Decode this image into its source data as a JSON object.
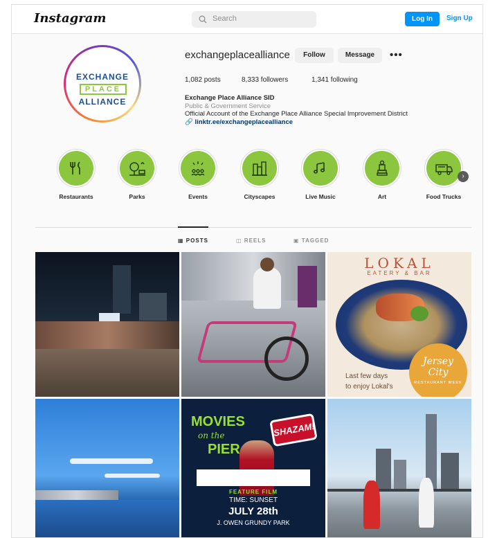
{
  "brand": {
    "logo_text": "Instagram"
  },
  "header": {
    "search_placeholder": "Search",
    "login_label": "Log In",
    "signup_label": "Sign Up"
  },
  "profile": {
    "avatar": {
      "line1": "EXCHANGE",
      "line2": "PLACE",
      "line3": "ALLIANCE"
    },
    "username": "exchangeplacealliance",
    "follow_label": "Follow",
    "message_label": "Message",
    "more_label": "•••",
    "stats": {
      "posts": "1,082 posts",
      "followers": "8,333 followers",
      "following": "1,341 following"
    },
    "bio": {
      "name": "Exchange Place Alliance SID",
      "category": "Public & Government Service",
      "text": "Official Account of the Exchange Place Alliance Special Improvement District",
      "link": "linktr.ee/exchangeplacealliance"
    }
  },
  "highlights": [
    {
      "label": "Restaurants",
      "icon": "utensils-icon"
    },
    {
      "label": "Parks",
      "icon": "tree-icon"
    },
    {
      "label": "Events",
      "icon": "confetti-icon"
    },
    {
      "label": "Cityscapes",
      "icon": "city-icon"
    },
    {
      "label": "Live Music",
      "icon": "music-notes-icon"
    },
    {
      "label": "Art",
      "icon": "statue-icon"
    },
    {
      "label": "Food Trucks",
      "icon": "food-truck-icon"
    }
  ],
  "tabs": [
    {
      "label": "POSTS",
      "active": true
    },
    {
      "label": "REELS",
      "active": false
    },
    {
      "label": "TAGGED",
      "active": false
    }
  ],
  "posts": {
    "lokal": {
      "title": "LOKAL",
      "subtitle": "EATERY & BAR",
      "caption_line1": "Last few days",
      "caption_line2": "to enjoy Lokal's",
      "badge_line1": "Jersey",
      "badge_line2": "City",
      "badge_small": "RESTAURANT WEEK"
    },
    "movies": {
      "title": "MOVIES",
      "on_the": "on the",
      "pier": "PIER",
      "film": "SHAZAM!",
      "feature": "FEATURE FILM",
      "time": "TIME: SUNSET",
      "date": "JULY 28th",
      "park": "J. OWEN GRUNDY PARK"
    }
  },
  "colors": {
    "accent_blue": "#0095f6",
    "highlight_green": "#8cc63f",
    "link_navy": "#00376b"
  }
}
